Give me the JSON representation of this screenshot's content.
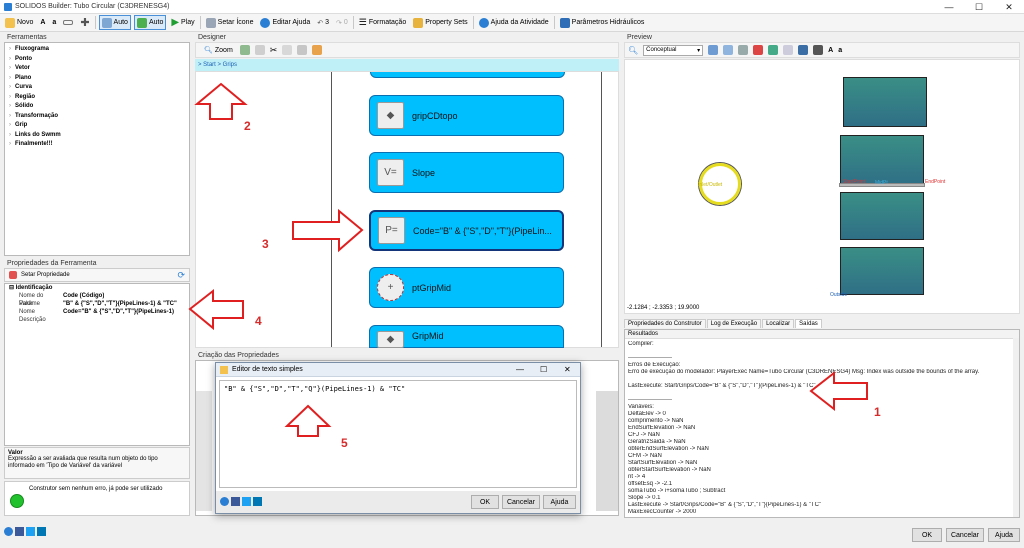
{
  "window": {
    "title": "SOLIDOS Builder: Tubo Circular (C3DRENESG4)"
  },
  "toolbar": {
    "novo": "Novo",
    "a1": "A",
    "a2": "a",
    "auto1": "Auto",
    "auto2": "Auto",
    "play": "Play",
    "setar_icone": "Setar Ícone",
    "editar_ajuda": "Editar Ajuda",
    "counter": "3",
    "counter2": "0",
    "formatacao": "Formatação",
    "property_sets": "Property Sets",
    "ajuda_atividade": "Ajuda da Atividade",
    "parametros": "Parâmetros Hidráulicos"
  },
  "ferramentas": {
    "title": "Ferramentas",
    "items": [
      "Fluxograma",
      "Ponto",
      "Vetor",
      "Plano",
      "Curva",
      "Região",
      "Sólido",
      "Transformação",
      "Grip",
      "Links do Swmm",
      "Finalmente!!!"
    ]
  },
  "propriedades": {
    "title": "Propriedades da Ferramenta",
    "setar": "Setar Propriedade",
    "group": "Identificação",
    "rows": [
      {
        "k": "Nome do Parâme",
        "v": "Code (Código)"
      },
      {
        "k": "Valor",
        "v": "\"B\" & {\"S\",\"D\",\"T\"}(PipeLines-1) & \"TC\""
      },
      {
        "k": "Nome",
        "v": "Code=\"B\" & {\"S\",\"D\",\"T\"}(PipeLines-1)"
      },
      {
        "k": "Descrição",
        "v": ""
      }
    ],
    "help_title": "Valor",
    "help_text": "Expressão a ser avaliada que resulta num objeto do tipo informado em 'Tipo de Variável' da variável",
    "status": "Construtor sem nenhum erro, já pode ser utilizado"
  },
  "designer": {
    "title": "Designer",
    "zoom": "Zoom",
    "breadcrumb": "> Start > Grips",
    "nodes": [
      "gripCDtopo",
      "Slope",
      "Code=\"B\" & {\"S\",\"D\",\"T\"}(PipeLin...",
      "ptGripMid",
      "GripMid"
    ]
  },
  "criacao": {
    "title": "Criação das Propriedades"
  },
  "editor": {
    "title": "Editor de texto simples",
    "text": "\"B\" & {\"S\",\"D\",\"T\",\"Q\"}(PipeLines-1) & \"TC\"",
    "ok": "OK",
    "cancelar": "Cancelar",
    "ajuda": "Ajuda"
  },
  "preview": {
    "title": "Preview",
    "view": "Conceptual",
    "a1": "A",
    "a2": "a",
    "coords": "-2.1284 ; -2.3353 ; 19.9000",
    "labels": {
      "inlet": "Inlet/Outlet",
      "start": "StartPoint",
      "mid": "MidPt",
      "end": "EndPoint",
      "outside": "Outside"
    }
  },
  "resultados": {
    "tabs": [
      "Propriedades do Construtor",
      "Log de Execução",
      "Localizar",
      "Saídas"
    ],
    "header": "Resultados",
    "lines": [
      "Compiler:",
      "",
      "----------------------",
      "Erros de Execução:",
      "Erro de execução do modelador: PlayerExec Name=Tubo Circular (C3DRENESG4) Msg: Index was outside the bounds of the array.",
      "",
      "LastExecute: Start/Grips/Code=\"B\" & {\"S\",\"D\",\"T\"}(PipeLines-1) & \"TC\"",
      "",
      "----------------------",
      "Variáveis:",
      "DeltaElev -> 0",
      "comprimento -> NaN",
      "EndSurfElevation -> NaN",
      "CFJ -> NaN",
      "GeratrizSaida -> NaN",
      "obterEndSurfElevation -> NaN",
      "CFM -> NaN",
      "StartSurfElevation -> NaN",
      "obterStartSurfElevation -> NaN",
      "nt -> 4",
      "offsetEsq -> -2.1",
      "somaTubo -> i+somaTubo ; Subtract",
      "Slope -> 0.1",
      "LastExecute -> Start/Grips/Code=\"B\" & {\"S\",\"D\",\"T\"}(PipeLines-1) & \"TC\"",
      "MaxExecCounter -> 2000"
    ]
  },
  "footer": {
    "ok": "OK",
    "cancelar": "Cancelar",
    "ajuda": "Ajuda"
  },
  "annotations": [
    "1",
    "2",
    "3",
    "4",
    "5"
  ]
}
